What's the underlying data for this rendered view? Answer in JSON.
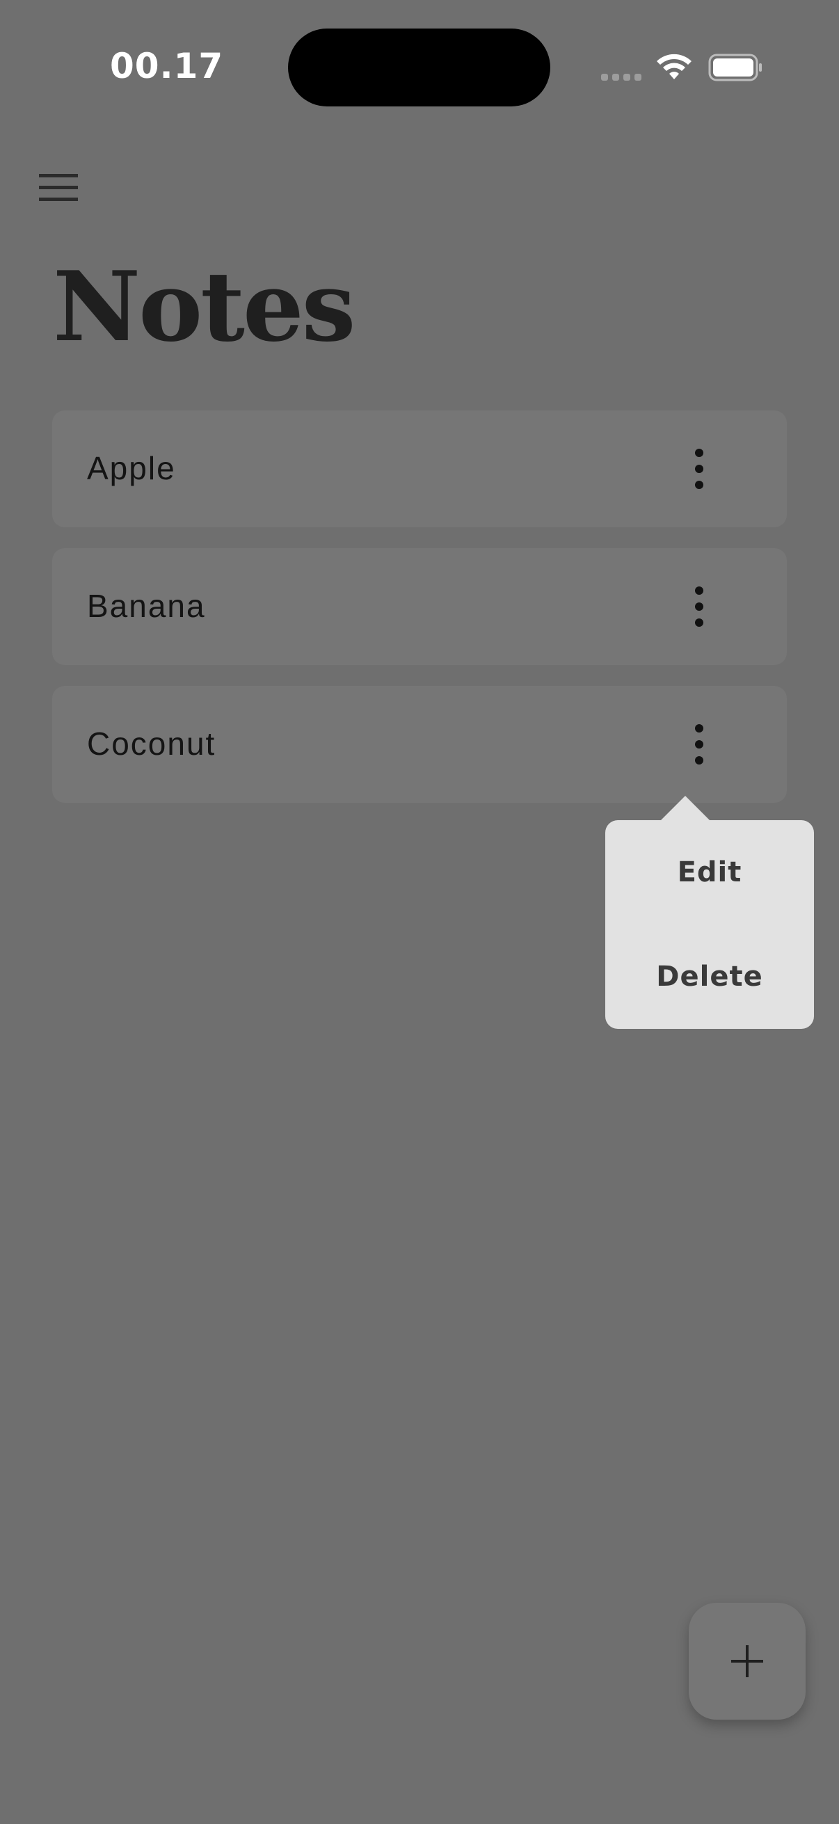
{
  "status_bar": {
    "time": "00.17",
    "icons": [
      "signal-icon",
      "wifi-icon",
      "battery-icon"
    ]
  },
  "header": {
    "menu_icon": "hamburger-menu-icon",
    "title": "Notes"
  },
  "notes": [
    {
      "title": "Apple"
    },
    {
      "title": "Banana"
    },
    {
      "title": "Coconut"
    }
  ],
  "note_menu_icon": "more-vertical-icon",
  "popup_menu": {
    "anchor_note": "Coconut",
    "items": [
      {
        "label": "Edit"
      },
      {
        "label": "Delete"
      }
    ]
  },
  "fab": {
    "icon": "plus-icon"
  },
  "colors": {
    "background": "#6f6f6f",
    "card": "#767676",
    "popup": "#e2e2e2",
    "title_text": "#1f1f1f"
  }
}
